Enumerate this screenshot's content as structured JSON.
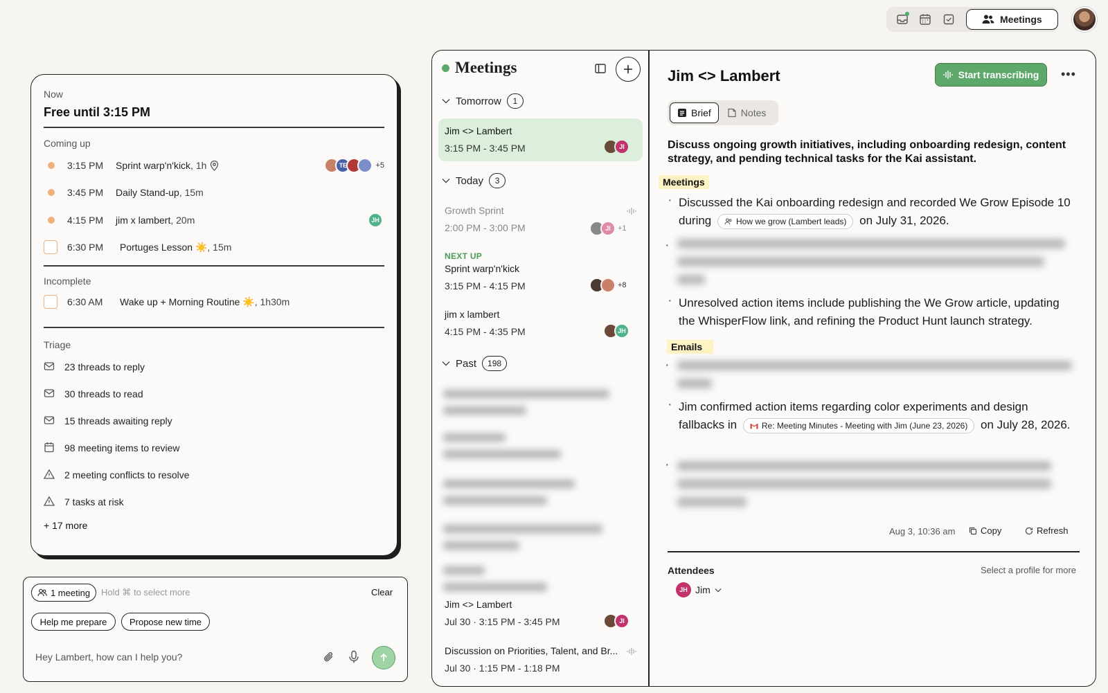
{
  "toolbar": {
    "meetings_label": "Meetings",
    "icons": [
      "inbox-icon",
      "calendar-icon",
      "checkbox-icon",
      "people-icon"
    ]
  },
  "left": {
    "now_label": "Now",
    "free_until": "Free until 3:15 PM",
    "coming_up_label": "Coming up",
    "coming_up": [
      {
        "time": "3:15 PM",
        "title": "Sprint warp'n'kick",
        "meta": ", 1h",
        "extra": "+5"
      },
      {
        "time": "3:45 PM",
        "title": "Daily Stand-up",
        "meta": ", 15m"
      },
      {
        "time": "4:15 PM",
        "title": "jim x lambert",
        "meta": ", 20m",
        "avatar": "JH"
      },
      {
        "time": "6:30 PM",
        "title": "Portuges Lesson ☀️",
        "meta": ", 15m"
      }
    ],
    "te_initials": "TE",
    "incomplete_label": "Incomplete",
    "incomplete": [
      {
        "time": "6:30 AM",
        "title": "Wake up + Morning Routine ☀️",
        "meta": ", 1h30m"
      }
    ],
    "triage_label": "Triage",
    "triage": [
      {
        "icon": "mail-icon",
        "text": "23 threads to reply"
      },
      {
        "icon": "mail-icon",
        "text": "30 threads to read"
      },
      {
        "icon": "mail-icon",
        "text": "15 threads awaiting reply"
      },
      {
        "icon": "calendar-icon",
        "text": "98 meeting items to review"
      },
      {
        "icon": "warning-icon",
        "text": "2 meeting conflicts to resolve"
      },
      {
        "icon": "warning-icon",
        "text": "7 tasks at risk"
      }
    ],
    "more": "+ 17 more"
  },
  "chat": {
    "meeting_pill": "1 meeting",
    "hint": "Hold ⌘ to select more",
    "clear": "Clear",
    "suggestion_1": "Help me prepare",
    "suggestion_2": "Propose new time",
    "placeholder": "Hey Lambert, how can I help you?"
  },
  "meetings": {
    "title": "Meetings",
    "tomorrow_label": "Tomorrow",
    "tomorrow_count": "1",
    "selected": {
      "name": "Jim <> Lambert",
      "time": "3:15 PM - 3:45 PM",
      "avatar": "JI"
    },
    "today_label": "Today",
    "today_count": "3",
    "today": [
      {
        "name": "Growth Sprint",
        "time": "2:00 PM - 3:00 PM",
        "avatar": "JI",
        "extra": "+1"
      },
      {
        "next_up": "NEXT UP",
        "name": "Sprint warp'n'kick",
        "time": "3:15 PM - 4:15 PM",
        "extra": "+8"
      },
      {
        "name": "jim x lambert",
        "time": "4:15 PM - 4:35 PM",
        "avatar": "JH"
      }
    ],
    "past_label": "Past",
    "past_count": "198",
    "past_visible": [
      {
        "name": "Jim <> Lambert",
        "time": "Jul 30 · 3:15 PM - 3:45 PM",
        "avatar": "JI"
      },
      {
        "name": "Discussion on Priorities, Talent, and Br...",
        "time": "Jul 30 · 1:15 PM - 1:18 PM"
      }
    ]
  },
  "detail": {
    "title": "Jim <> Lambert",
    "start_transcribing": "Start transcribing",
    "tab_brief": "Brief",
    "tab_notes": "Notes",
    "summary": "Discuss ongoing growth initiatives, including onboarding redesign, content strategy, and pending technical tasks for the Kai assistant.",
    "meetings_heading": "Meetings",
    "m1_a": "Discussed the Kai onboarding redesign and recorded We Grow Episode 10 during",
    "m1_chip": "How we grow (Lambert leads)",
    "m1_b": "on July 31, 2026.",
    "m3": "Unresolved action items include publishing the We Grow article, updating the WhisperFlow link, and refining the Product Hunt launch strategy.",
    "emails_heading": "Emails",
    "e2_a": "Jim confirmed action items regarding color experiments and design fallbacks in",
    "e2_chip": "Re: Meeting Minutes - Meeting with Jim (June 23, 2026)",
    "e2_b": "on July 28, 2026.",
    "timestamp": "Aug 3, 10:36 am",
    "copy": "Copy",
    "refresh": "Refresh",
    "attendees_label": "Attendees",
    "attendees_hint": "Select a profile for more",
    "attendee_initials": "JH",
    "attendee_name": "Jim"
  },
  "colors": {
    "accent_green": "#5ea86b",
    "dot_orange": "#f0b07b",
    "highlight": "#fdf2c4",
    "selected_row": "#dcefdc"
  }
}
